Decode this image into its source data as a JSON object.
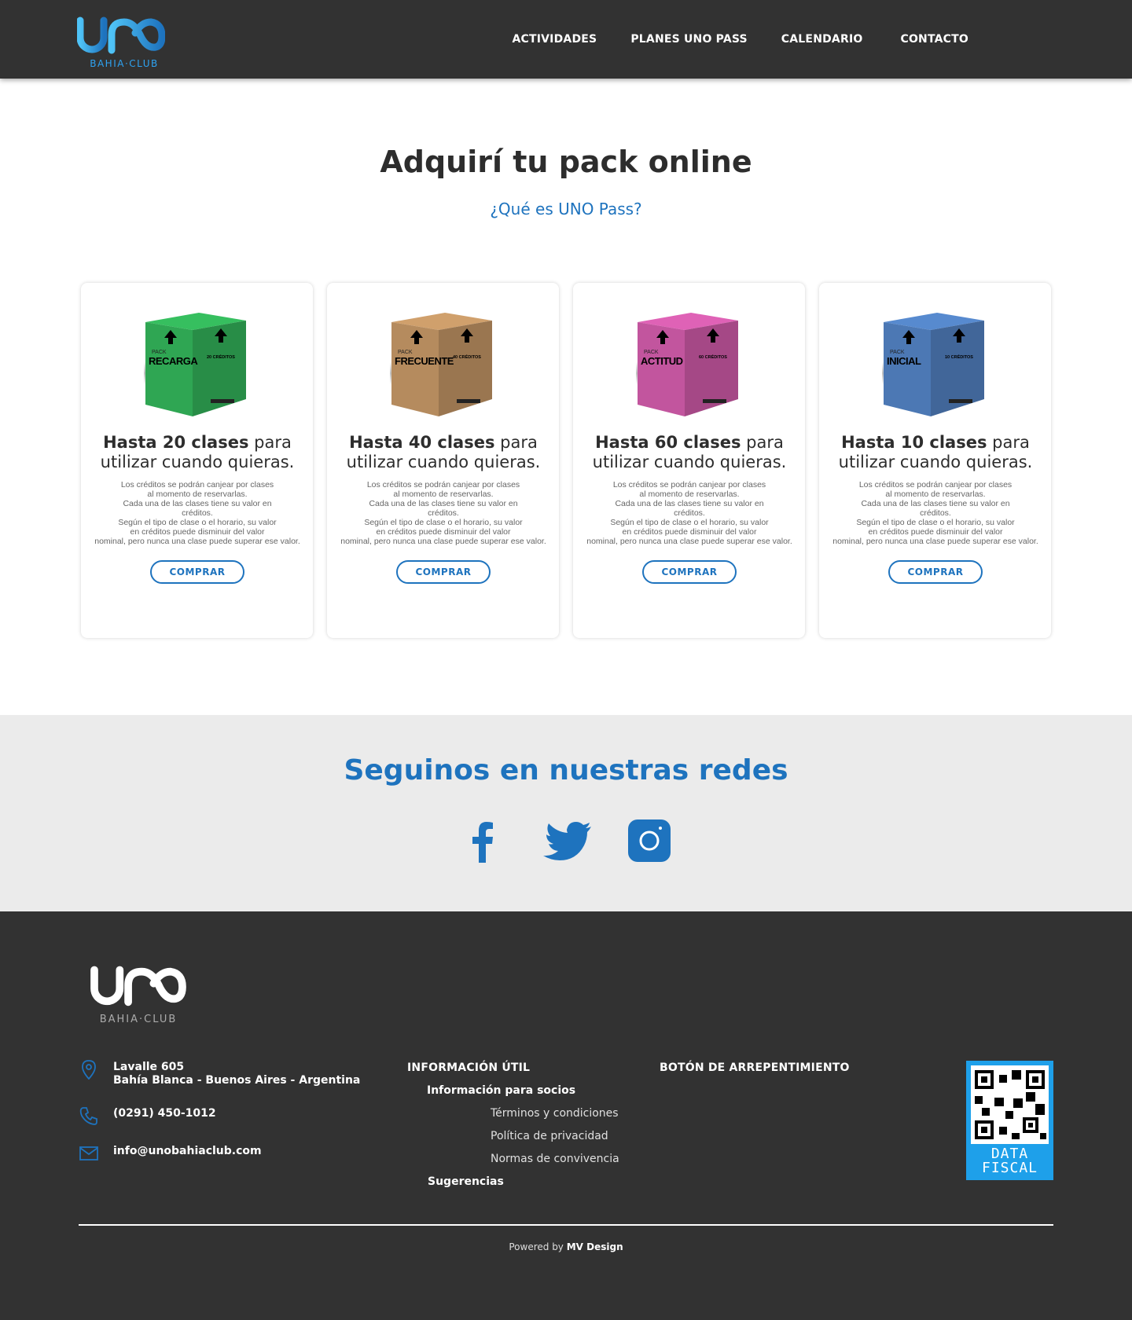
{
  "header": {
    "logo_text": "UNO",
    "logo_sub": "BAHIA·CLUB",
    "nav": [
      "ACTIVIDADES",
      "PLANES UNO PASS",
      "CALENDARIO",
      "CONTACTO"
    ]
  },
  "hero": {
    "title": "Adquirí tu pack online",
    "link": "¿Qué es UNO Pass?"
  },
  "cards": [
    {
      "pack_label": "PACK",
      "pack_name": "RECARGA",
      "box_side_text": "20 CRÉDITOS",
      "box_color": "#2fa653",
      "title_bold": "Hasta 20 clases",
      "title_rest": " para utilizar cuando quieras.",
      "description": "Los créditos se podrán canjear por clases\nal momento de reservarlas.\nCada una de las clases tiene su valor en\ncréditos.\nSegún el tipo de clase o el horario, su valor\nen créditos puede disminuir del valor\nnominal, pero nunca una clase puede superar ese valor.",
      "button": "COMPRAR"
    },
    {
      "pack_label": "PACK",
      "pack_name": "FRECUENTE",
      "box_side_text": "40 CRÉDITOS",
      "box_color": "#b58b5e",
      "title_bold": "Hasta 40 clases",
      "title_rest": " para utilizar cuando quieras.",
      "description": "Los créditos se podrán canjear por clases\nal momento de reservarlas.\nCada una de las clases tiene su valor en\ncréditos.\nSegún el tipo de clase o el horario, su valor\nen créditos puede disminuir del valor\nnominal, pero nunca una clase puede superar ese valor.",
      "button": "COMPRAR"
    },
    {
      "pack_label": "PACK",
      "pack_name": "ACTITUD",
      "box_side_text": "60 CRÉDITOS",
      "box_color": "#c2559e",
      "title_bold": "Hasta 60 clases",
      "title_rest": " para utilizar cuando quieras.",
      "description": "Los créditos se podrán canjear por clases\nal momento de reservarlas.\nCada una de las clases tiene su valor en\ncréditos.\nSegún el tipo de clase o el horario, su valor\nen créditos puede disminuir del valor\nnominal, pero nunca una clase puede superar ese valor.",
      "button": "COMPRAR"
    },
    {
      "pack_label": "PACK",
      "pack_name": "INICIAL",
      "box_side_text": "10 CRÉDITOS",
      "box_color": "#4c78b4",
      "title_bold": "Hasta 10 clases",
      "title_rest": " para utilizar cuando quieras.",
      "description": "Los créditos se podrán canjear por clases\nal momento de reservarlas.\nCada una de las clases tiene su valor en\ncréditos.\nSegún el tipo de clase o el horario, su valor\nen créditos puede disminuir del valor\nnominal, pero nunca una clase puede superar ese valor.",
      "button": "COMPRAR"
    }
  ],
  "social": {
    "title": "Seguinos en nuestras redes",
    "icons": [
      "facebook-icon",
      "twitter-icon",
      "instagram-icon"
    ]
  },
  "footer": {
    "logo_text": "UNO",
    "logo_sub": "BAHIA·CLUB",
    "address_line1": "Lavalle 605",
    "address_line2": "Bahía Blanca - Buenos Aires - Argentina",
    "phone": "(0291) 450-1012",
    "email": "info@unobahiaclub.com",
    "info_title": "INFORMACIÓN ÚTIL",
    "info_socios": "Información para socios",
    "terms": "Términos y condiciones",
    "privacy": "Política de privacidad",
    "norms": "Normas de convivencia",
    "suggestions": "Sugerencias",
    "arrepentimiento": "BOTÓN DE ARREPENTIMIENTO",
    "datafiscal_line1": "DATA",
    "datafiscal_line2": "FISCAL",
    "powered_prefix": "Powered by ",
    "powered_brand": "MV Design"
  },
  "colors": {
    "accent": "#1e73be",
    "dark": "#323232",
    "social_bg": "#ebebeb"
  }
}
